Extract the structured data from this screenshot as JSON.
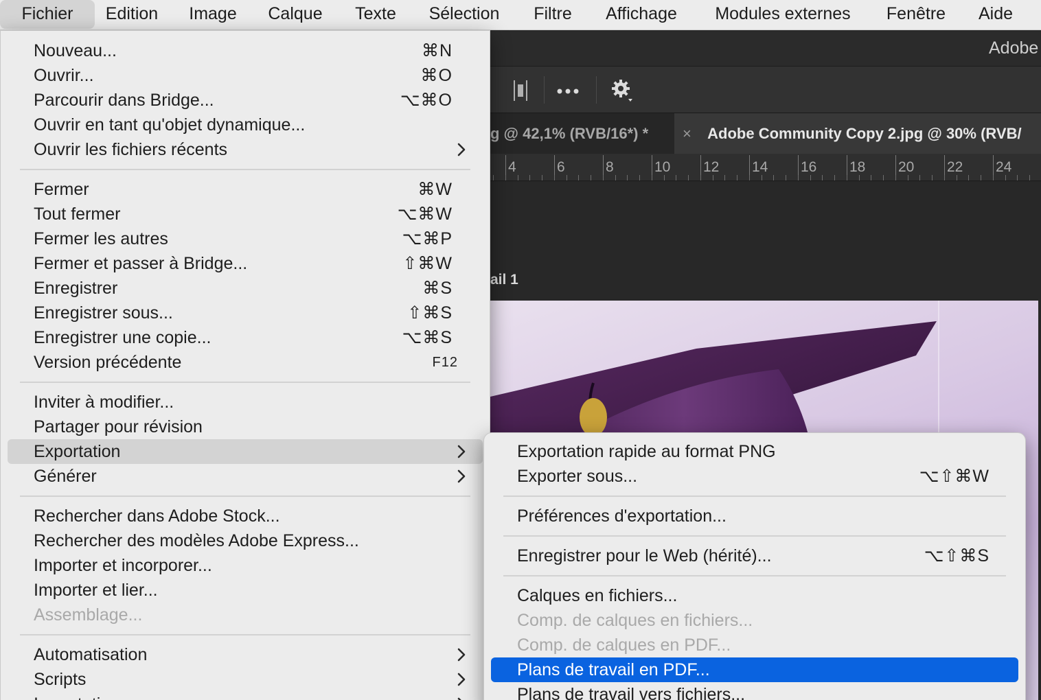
{
  "menubar": [
    {
      "label": "Fichier",
      "active": true
    },
    {
      "label": "Edition"
    },
    {
      "label": "Image"
    },
    {
      "label": "Calque"
    },
    {
      "label": "Texte"
    },
    {
      "label": "Sélection"
    },
    {
      "label": "Filtre"
    },
    {
      "label": "Affichage"
    },
    {
      "label": "Modules externes"
    },
    {
      "label": "Fenêtre"
    },
    {
      "label": "Aide"
    }
  ],
  "app": {
    "title": "Adobe"
  },
  "tabs": [
    {
      "label": "g @ 42,1% (RVB/16*) *",
      "active": false
    },
    {
      "label": "Adobe Community Copy 2.jpg @ 30% (RVB/",
      "active": true,
      "close": "×"
    }
  ],
  "ruler": {
    "labels": [
      "4",
      "6",
      "8",
      "10",
      "12",
      "14",
      "16",
      "18",
      "20",
      "22",
      "24"
    ]
  },
  "artboard": {
    "label": "ail 1"
  },
  "file_menu": {
    "items": [
      {
        "label": "Nouveau...",
        "shortcut": "⌘N"
      },
      {
        "label": "Ouvrir...",
        "shortcut": "⌘O"
      },
      {
        "label": "Parcourir dans Bridge...",
        "shortcut": "⌥⌘O"
      },
      {
        "label": "Ouvrir en tant qu'objet dynamique..."
      },
      {
        "label": "Ouvrir les fichiers récents",
        "submenu": true
      },
      {
        "separator": true
      },
      {
        "label": "Fermer",
        "shortcut": "⌘W"
      },
      {
        "label": "Tout fermer",
        "shortcut": "⌥⌘W"
      },
      {
        "label": "Fermer les autres",
        "shortcut": "⌥⌘P"
      },
      {
        "label": "Fermer et passer à Bridge...",
        "shortcut": "⇧⌘W"
      },
      {
        "label": "Enregistrer",
        "shortcut": "⌘S"
      },
      {
        "label": "Enregistrer sous...",
        "shortcut": "⇧⌘S"
      },
      {
        "label": "Enregistrer une copie...",
        "shortcut": "⌥⌘S"
      },
      {
        "label": "Version précédente",
        "shortcut": "F12",
        "small": true
      },
      {
        "separator": true
      },
      {
        "label": "Inviter à modifier..."
      },
      {
        "label": "Partager pour révision"
      },
      {
        "label": "Exportation",
        "submenu": true,
        "state": "hover"
      },
      {
        "label": "Générer",
        "submenu": true
      },
      {
        "separator": true
      },
      {
        "label": "Rechercher dans Adobe Stock..."
      },
      {
        "label": "Rechercher des modèles Adobe Express..."
      },
      {
        "label": "Importer et incorporer..."
      },
      {
        "label": "Importer et lier..."
      },
      {
        "label": "Assemblage...",
        "disabled": true
      },
      {
        "separator": true
      },
      {
        "label": "Automatisation",
        "submenu": true
      },
      {
        "label": "Scripts",
        "submenu": true
      },
      {
        "label": "Importation",
        "submenu": true
      }
    ]
  },
  "export_submenu": {
    "items": [
      {
        "label": "Exportation rapide au format PNG"
      },
      {
        "label": "Exporter sous...",
        "shortcut": "⌥⇧⌘W"
      },
      {
        "separator": true
      },
      {
        "label": "Préférences d'exportation..."
      },
      {
        "separator": true
      },
      {
        "label": "Enregistrer pour le Web (hérité)...",
        "shortcut": "⌥⇧⌘S"
      },
      {
        "separator": true
      },
      {
        "label": "Calques en fichiers..."
      },
      {
        "label": "Comp. de calques en fichiers...",
        "disabled": true
      },
      {
        "label": "Comp. de calques en PDF...",
        "disabled": true
      },
      {
        "label": "Plans de travail en PDF...",
        "state": "selected"
      },
      {
        "label": "Plans de travail vers fichiers..."
      }
    ]
  },
  "colors": {
    "menu_bg": "#ececec",
    "highlight_blue": "#0a63e0",
    "hover_gray": "#d3d3d3",
    "ps_dark": "#2b2b2b"
  }
}
